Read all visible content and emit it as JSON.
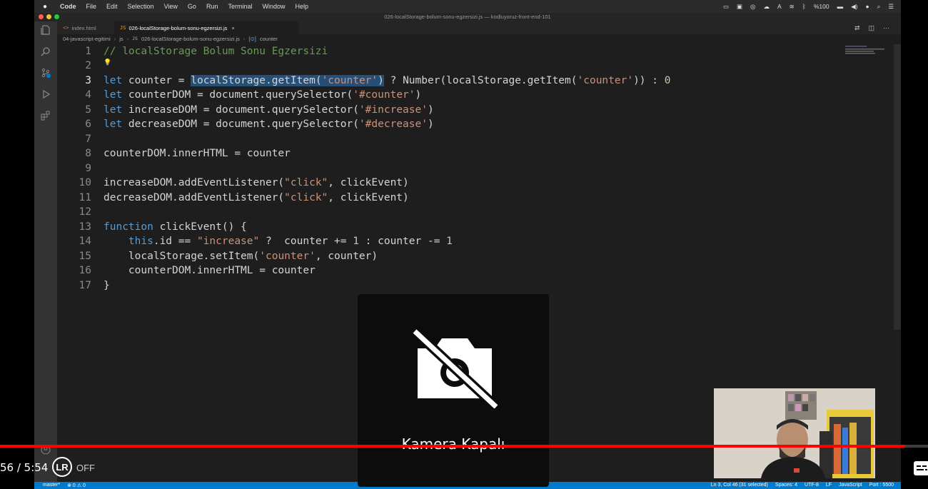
{
  "menubar": {
    "app": "Code",
    "items": [
      "File",
      "Edit",
      "Selection",
      "View",
      "Go",
      "Run",
      "Terminal",
      "Window",
      "Help"
    ],
    "battery": "%100"
  },
  "window": {
    "title": "026-localStorage-bolum-sonu-egzersizi.js — kodluyoruz-front-end-101"
  },
  "tabs": [
    {
      "icon": "<>",
      "label": "index.html"
    },
    {
      "icon": "JS",
      "label": "026-localStorage-bolum-sonu-egzersizi.js",
      "close": "×"
    }
  ],
  "breadcrumb": {
    "parts": [
      "04-javascript-egitimi",
      "js",
      "026-localStorage-bolum-sonu-egzersizi.js",
      "counter"
    ],
    "separator": "›",
    "js_icon": "JS"
  },
  "editor": {
    "line_numbers": [
      "1",
      "2",
      "3",
      "4",
      "5",
      "6",
      "7",
      "8",
      "9",
      "10",
      "11",
      "12",
      "13",
      "14",
      "15",
      "16",
      "17"
    ],
    "current_line": "3",
    "code": {
      "l1": "// localStorage Bolum Sonu Egzersizi",
      "l3_kw": "let",
      "l3_a": " counter = ",
      "l3_sel": "localStorage.getItem(",
      "l3_str1": "'counter'",
      "l3_selend": ")",
      "l3_b": " ? Number(localStorage.getItem(",
      "l3_str2": "'counter'",
      "l3_c": ")) : ",
      "l3_num": "0",
      "l4_kw": "let",
      "l4_a": " counterDOM = document.querySelector(",
      "l4_str": "'#counter'",
      "l4_b": ")",
      "l5_kw": "let",
      "l5_a": " increaseDOM = document.querySelector(",
      "l5_str": "'#increase'",
      "l5_b": ")",
      "l6_kw": "let",
      "l6_a": " decreaseDOM = document.querySelector(",
      "l6_str": "'#decrease'",
      "l6_b": ")",
      "l8": "counterDOM.innerHTML = counter",
      "l10_a": "increaseDOM.addEventListener(",
      "l10_str": "\"click\"",
      "l10_b": ", clickEvent)",
      "l11_a": "decreaseDOM.addEventListener(",
      "l11_str": "\"click\"",
      "l11_b": ", clickEvent)",
      "l13_kw": "function",
      "l13_a": " clickEvent() {",
      "l14_indent": "    ",
      "l14_kw": "this",
      "l14_a": ".id == ",
      "l14_str": "\"increase\"",
      "l14_b": " ?  counter += ",
      "l14_n1": "1",
      "l14_c": " : counter -= ",
      "l14_n2": "1",
      "l15_indent": "    ",
      "l15_a": "localStorage.setItem(",
      "l15_str": "'counter'",
      "l15_b": ", counter)",
      "l16_indent": "    ",
      "l16_a": "counterDOM.innerHTML = counter",
      "l17": "}"
    }
  },
  "statusbar": {
    "branch": "master*",
    "problems": "⊗ 0 ⚠ 0",
    "position": "Ln 3, Col 46 (31 selected)",
    "spaces": "Spaces: 4",
    "encoding": "UTF-8",
    "eol": "LF",
    "language": "JavaScript",
    "port": "Port : 5500"
  },
  "camera": {
    "label": "Kamera Kapalı"
  },
  "player": {
    "time": "56 / 5:54",
    "progress": 0.975,
    "lr_badge": "LR",
    "lr_state": "OFF",
    "progress_color": "#ff0000"
  },
  "colors": {
    "accent": "#007acc",
    "keyword": "#569cd6",
    "string": "#ce9178",
    "comment": "#6a9955"
  }
}
